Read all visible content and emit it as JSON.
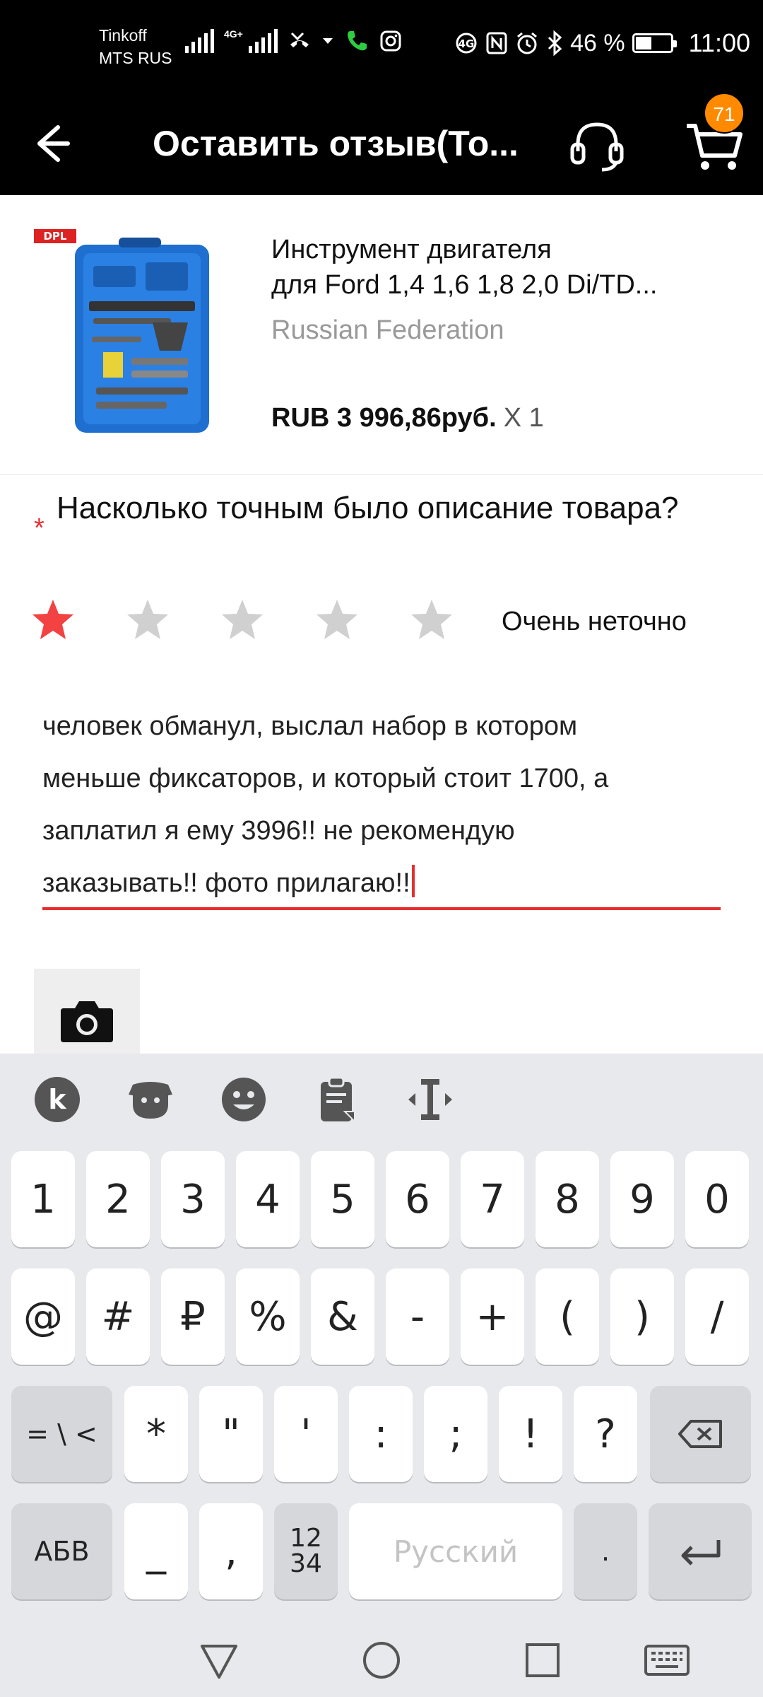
{
  "status_bar": {
    "carrier_line1": "Tinkoff",
    "carrier_line2": "MTS RUS",
    "network_type": "4G+",
    "battery_text": "46 %",
    "battery_level": 0.46,
    "time": "11:00"
  },
  "header": {
    "title": "Оставить отзыв(То...",
    "cart_count": "71",
    "accent_color": "#ff8a00"
  },
  "product": {
    "title_line1": "Инструмент двигателя",
    "title_line2": "для Ford 1,4 1,6 1,8 2,0 Di/TD...",
    "ships_from": "Russian Federation",
    "price": "RUB 3 996,86руб.",
    "quantity": "X 1",
    "image_brand": "DPL"
  },
  "rating": {
    "required_mark": "*",
    "question": "Насколько точным было описание товара?",
    "value": 1,
    "max": 5,
    "label": "Очень неточно",
    "active_color": "#f24242",
    "inactive_color": "#d0d0d0"
  },
  "review": {
    "line1": "человек обманул, выслал набор в котором",
    "line2": "меньше фиксаторов, и который стоит 1700, а",
    "line3": "заплатил я ему 3996!! не рекомендую",
    "line4": "заказывать!! фото прилагаю!!"
  },
  "keyboard": {
    "row1": [
      "1",
      "2",
      "3",
      "4",
      "5",
      "6",
      "7",
      "8",
      "9",
      "0"
    ],
    "row2": [
      "@",
      "#",
      "₽",
      "%",
      "&",
      "-",
      "+",
      "(",
      ")",
      "/"
    ],
    "row3": [
      "*",
      "\"",
      "'",
      ":",
      ";",
      "!",
      "?"
    ],
    "symbols_key": "= \\ <",
    "lang_key": "АБВ",
    "underscore_key": "_",
    "comma_key": ",",
    "numpad_key_top": "12",
    "numpad_key_bottom": "34",
    "space_label": "Русский",
    "period_key": ".",
    "icons": [
      "keyboard-logo-icon",
      "sticker-icon",
      "emoji-icon",
      "clipboard-icon",
      "cursor-icon",
      "backspace-icon",
      "enter-icon"
    ]
  },
  "nav_bar": {
    "icons": [
      "back-triangle-icon",
      "home-circle-icon",
      "recents-square-icon",
      "keyboard-switch-icon"
    ]
  }
}
